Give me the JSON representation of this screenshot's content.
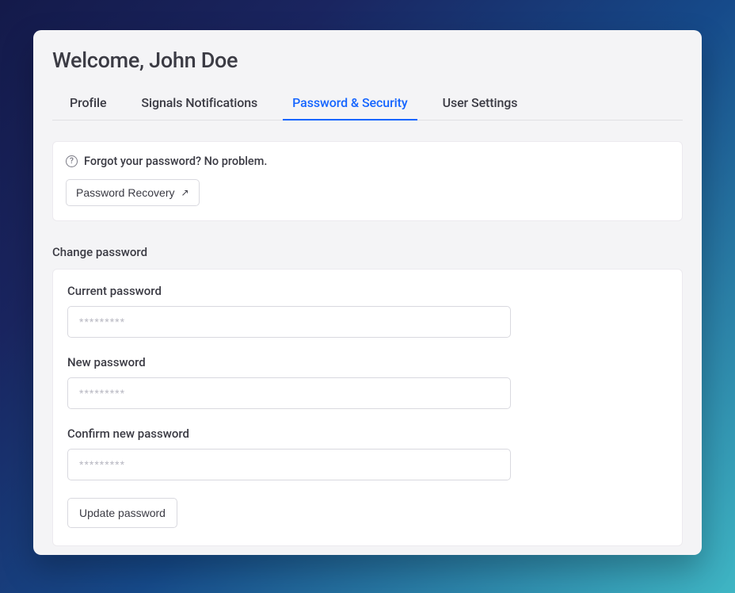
{
  "header": {
    "title": "Welcome, John Doe"
  },
  "tabs": [
    {
      "label": "Profile",
      "active": false
    },
    {
      "label": "Signals Notifications",
      "active": false
    },
    {
      "label": "Password & Security",
      "active": true
    },
    {
      "label": "User Settings",
      "active": false
    }
  ],
  "forgot_panel": {
    "message": "Forgot your password? No problem.",
    "recovery_button": "Password Recovery"
  },
  "change_password": {
    "heading": "Change password",
    "fields": {
      "current": {
        "label": "Current password",
        "placeholder": "*********"
      },
      "new": {
        "label": "New password",
        "placeholder": "*********"
      },
      "confirm": {
        "label": "Confirm new password",
        "placeholder": "*********"
      }
    },
    "update_button": "Update password"
  }
}
